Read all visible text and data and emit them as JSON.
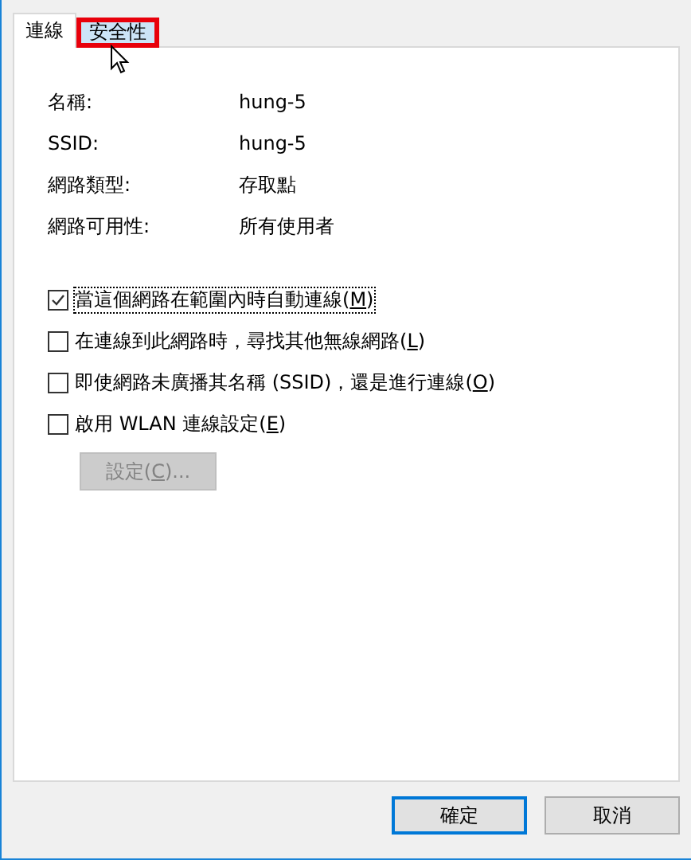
{
  "tabs": [
    {
      "label": "連線",
      "selected": true,
      "highlighted": false
    },
    {
      "label": "安全性",
      "selected": false,
      "highlighted": true
    }
  ],
  "properties": [
    {
      "label": "名稱:",
      "value": "hung-5"
    },
    {
      "label": "SSID:",
      "value": "hung-5"
    },
    {
      "label": "網路類型:",
      "value": "存取點"
    },
    {
      "label": "網路可用性:",
      "value": "所有使用者"
    }
  ],
  "options": [
    {
      "before": "當這個網路在範圍內時自動連線(",
      "key": "M",
      "after": ")",
      "checked": true,
      "focused": true
    },
    {
      "before": "在連線到此網路時，尋找其他無線網路(",
      "key": "L",
      "after": ")",
      "checked": false,
      "focused": false
    },
    {
      "before": "即使網路未廣播其名稱 (SSID)，還是進行連線(",
      "key": "O",
      "after": ")",
      "checked": false,
      "focused": false
    },
    {
      "before": "啟用 WLAN 連線設定(",
      "key": "E",
      "after": ")",
      "checked": false,
      "focused": false
    }
  ],
  "settings_button": {
    "before": "設定(",
    "key": "C",
    "after": ")...",
    "disabled": true
  },
  "buttons": [
    {
      "label": "確定",
      "default": true
    },
    {
      "label": "取消",
      "default": false
    }
  ]
}
